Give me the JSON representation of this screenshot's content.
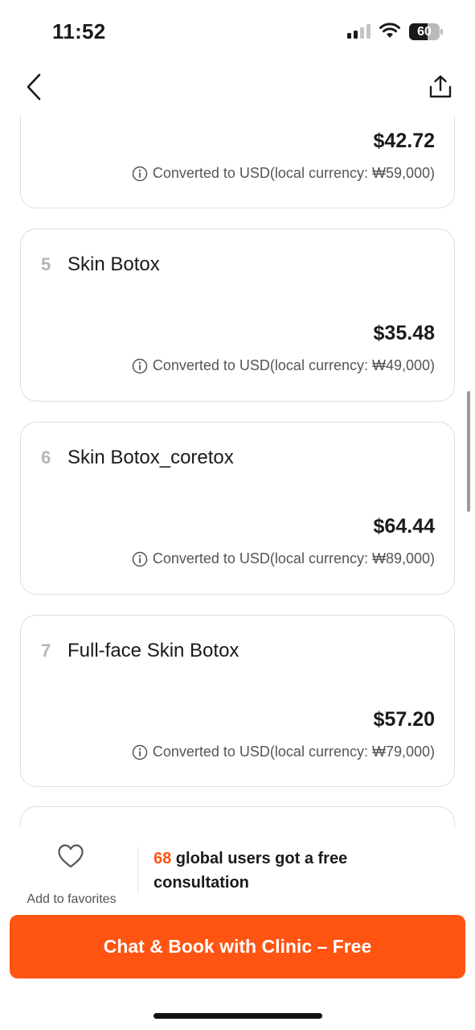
{
  "status_bar": {
    "time": "11:52",
    "battery_percent": "60",
    "signal_bars_active": 2,
    "signal_bars_total": 4
  },
  "nav": {
    "back_icon": "chevron-left-icon",
    "share_icon": "share-icon"
  },
  "items": [
    {
      "index": "",
      "title": "",
      "price": "$42.72",
      "note": "Converted to USD(local currency: ₩59,000)"
    },
    {
      "index": "5",
      "title": "Skin Botox",
      "price": "$35.48",
      "note": "Converted to USD(local currency: ₩49,000)"
    },
    {
      "index": "6",
      "title": "Skin Botox_coretox",
      "price": "$64.44",
      "note": "Converted to USD(local currency: ₩89,000)"
    },
    {
      "index": "7",
      "title": "Full-face Skin Botox",
      "price": "$57.20",
      "note": "Converted to USD(local currency: ₩79,000)"
    }
  ],
  "bottom": {
    "favorites_label": "Add to favorites",
    "consult_count": "68",
    "consult_text": " global users got a free consultation",
    "cta_label": "Chat & Book with Clinic – Free"
  },
  "colors": {
    "accent": "#ff5412",
    "card_border": "#dedede",
    "muted_text": "#555555",
    "index_text": "#b5b5b5"
  }
}
